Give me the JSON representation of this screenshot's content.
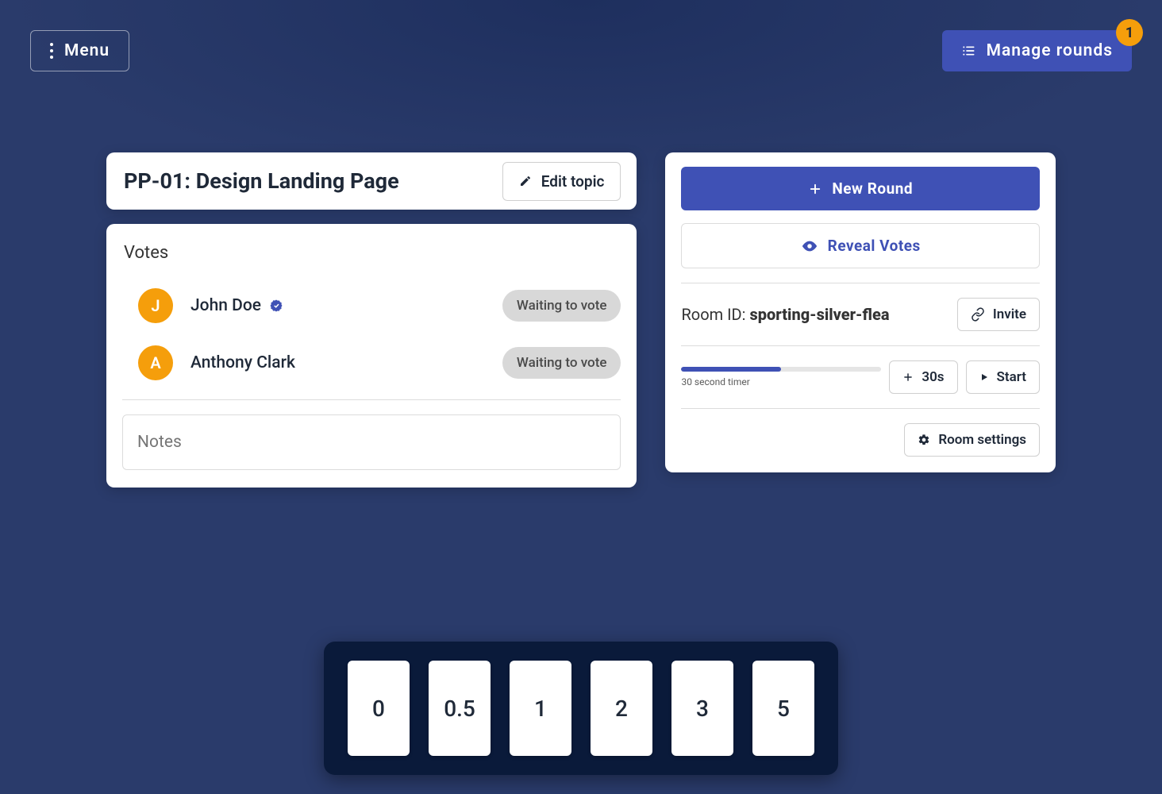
{
  "header": {
    "menu_label": "Menu",
    "manage_rounds_label": "Manage rounds",
    "rounds_badge": "1"
  },
  "topic": {
    "title": "PP-01: Design Landing Page",
    "edit_label": "Edit topic"
  },
  "votes": {
    "heading": "Votes",
    "voters": [
      {
        "initial": "J",
        "name": "John Doe",
        "verified": true,
        "status": "Waiting to vote"
      },
      {
        "initial": "A",
        "name": "Anthony Clark",
        "verified": false,
        "status": "Waiting to vote"
      }
    ],
    "notes_placeholder": "Notes"
  },
  "actions": {
    "new_round_label": "New Round",
    "reveal_votes_label": "Reveal Votes",
    "room_label_prefix": "Room ID: ",
    "room_id": "sporting-silver-flea",
    "invite_label": "Invite",
    "timer_add_label": "30s",
    "timer_start_label": "Start",
    "timer_caption": "30 second timer",
    "timer_progress_pct": 50,
    "room_settings_label": "Room settings"
  },
  "cards": [
    "0",
    "0.5",
    "1",
    "2",
    "3",
    "5"
  ],
  "colors": {
    "primary": "#3f51b5",
    "orange": "#f59e0b",
    "deck_bg": "#0a1a3a",
    "bg": "#2a3b6b"
  }
}
